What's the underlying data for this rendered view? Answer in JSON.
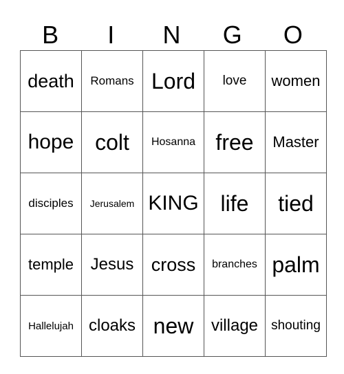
{
  "header": [
    "B",
    "I",
    "N",
    "G",
    "O"
  ],
  "rows": [
    [
      "death",
      "Romans",
      "Lord",
      "love",
      "women"
    ],
    [
      "hope",
      "colt",
      "Hosanna",
      "free",
      "Master"
    ],
    [
      "disciples",
      "Jerusalem",
      "KING",
      "life",
      "tied"
    ],
    [
      "temple",
      "Jesus",
      "cross",
      "branches",
      "palm"
    ],
    [
      "Hallelujah",
      "cloaks",
      "new",
      "village",
      "shouting"
    ]
  ]
}
